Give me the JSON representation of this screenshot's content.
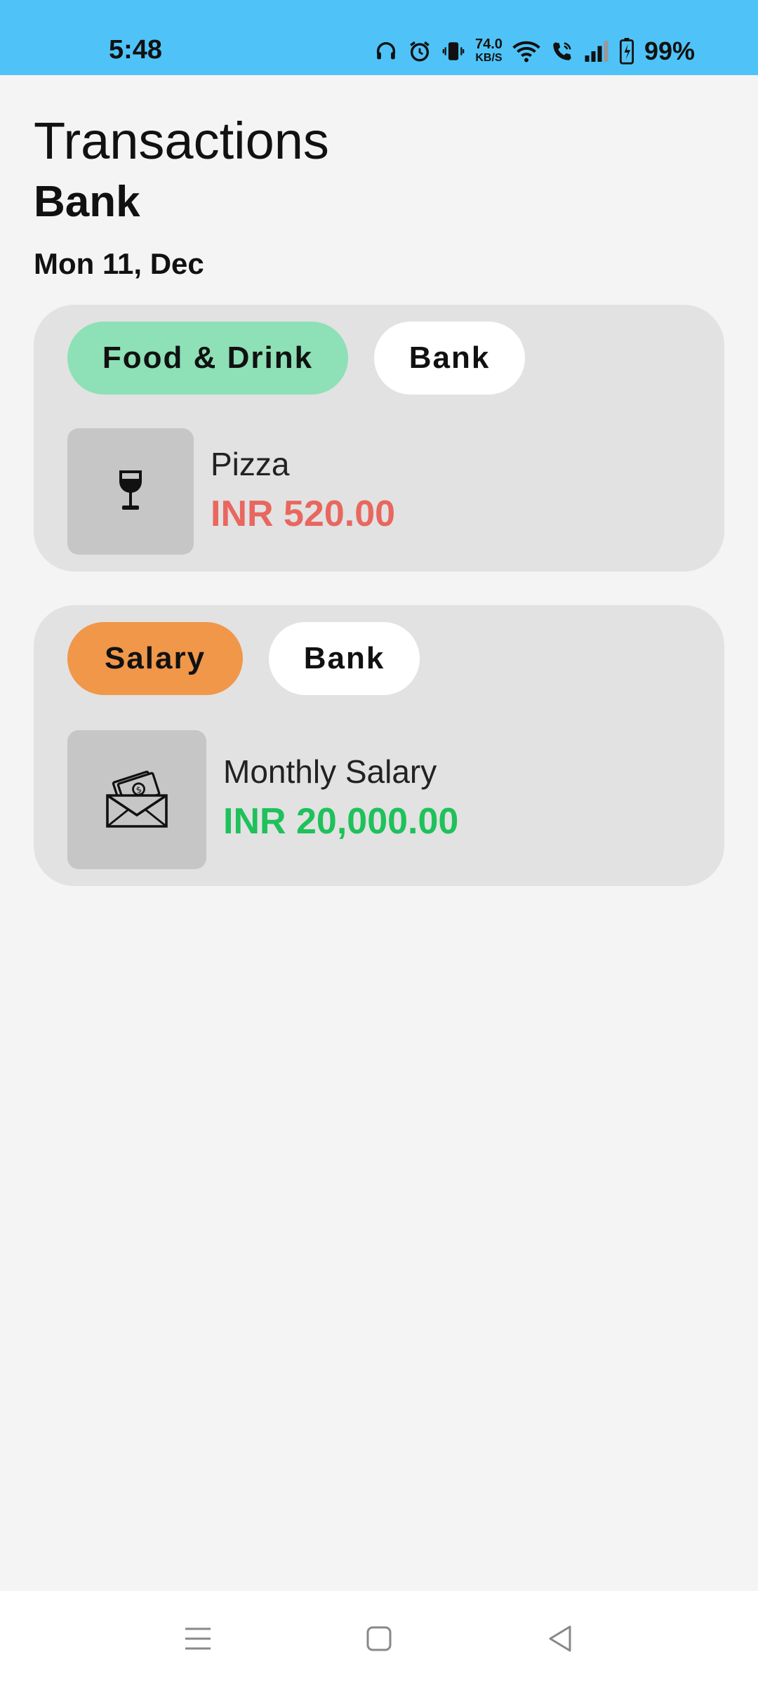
{
  "status_bar": {
    "time": "5:48",
    "net_speed_value": "74.0",
    "net_speed_unit": "KB/S",
    "battery": "99%",
    "icons": [
      "headphones-icon",
      "alarm-icon",
      "vibrate-icon",
      "wifi-icon",
      "wifi-call-icon",
      "signal-icon",
      "battery-icon"
    ]
  },
  "header": {
    "title": "Transactions",
    "subtitle": "Bank",
    "date": "Mon 11, Dec"
  },
  "transactions": [
    {
      "category": "Food & Drink",
      "account": "Bank",
      "name": "Pizza",
      "amount": "INR 520.00",
      "icon": "wine-glass-icon",
      "category_color": "#8ee0b6",
      "amount_color": "#e8675f"
    },
    {
      "category": "Salary",
      "account": "Bank",
      "name": "Monthly Salary",
      "amount": "INR 20,000.00",
      "icon": "money-envelope-icon",
      "category_color": "#f0974a",
      "amount_color": "#1ec15a"
    }
  ],
  "colors": {
    "status_bar": "#4fc3f7",
    "background": "#f4f4f4",
    "card": "#e2e2e2"
  },
  "nav_bar": {
    "icons": [
      "menu-icon",
      "home-icon",
      "back-icon"
    ]
  }
}
